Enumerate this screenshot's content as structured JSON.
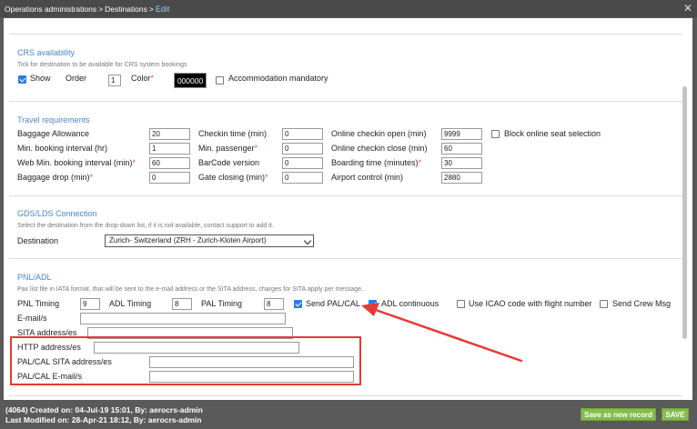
{
  "breadcrumb": {
    "items": [
      "Operations administrations",
      "Destinations",
      "Edit"
    ],
    "separator": ">"
  },
  "window": {
    "close_glyph": "✕"
  },
  "crs": {
    "title": "CRS availability",
    "description": "Tick for destination to be available for CRS system bookings",
    "show_label": "Show",
    "show_checked": true,
    "order_label": "Order",
    "order_value": "1",
    "color_label": "Color",
    "color_value": "000000",
    "accommodation_label": "Accommodation mandatory",
    "accommodation_checked": false
  },
  "travel": {
    "title": "Travel requirements",
    "baggage_allowance_label": "Baggage Allowance",
    "baggage_allowance_value": "20",
    "min_booking_label": "Min. booking interval (hr)",
    "min_booking_value": "1",
    "web_min_booking_label": "Web Min. booking interval (min)",
    "web_min_booking_value": "60",
    "baggage_drop_label": "Baggage drop (min)",
    "baggage_drop_value": "0",
    "checkin_time_label": "Checkin time (min)",
    "checkin_time_value": "0",
    "min_passenger_label": "Min. passenger",
    "min_passenger_value": "0",
    "barcode_label": "BarCode version",
    "barcode_value": "0",
    "gate_closing_label": "Gate closing (min)",
    "gate_closing_value": "0",
    "online_open_label": "Online checkin open (min)",
    "online_open_value": "9999",
    "online_close_label": "Online checkin close (min)",
    "online_close_value": "60",
    "boarding_label": "Boarding time (minutes)",
    "boarding_value": "30",
    "airport_control_label": "Airport control (min)",
    "airport_control_value": "2880",
    "block_online_label": "Block online seat selection",
    "block_online_checked": false,
    "required_mark": "*"
  },
  "gds": {
    "title": "GDS/LDS Connection",
    "description": "Select the destination from the drop-down list, if it is not available, contact support to add it.",
    "destination_label": "Destination",
    "destination_value": "Zurich- Switzerland (ZRH - Zurich-Kloten Airport)"
  },
  "pnl": {
    "title": "PNL/ADL",
    "description": "Pax list file in IATA format, that will be sent to the e-mail address or the SITA address, charges for SITA apply per message..",
    "pnl_timing_label": "PNL Timing",
    "pnl_timing_value": "9",
    "adl_timing_label": "ADL Timing",
    "adl_timing_value": "8",
    "pal_timing_label": "PAL Timing",
    "pal_timing_value": "8",
    "send_palcal_label": "Send PAL/CAL",
    "send_palcal_checked": true,
    "adl_continuous_label": "ADL continuous",
    "adl_continuous_checked": true,
    "icao_label": "Use ICAO code with flight number",
    "icao_checked": false,
    "send_crew_label": "Send Crew Msg",
    "send_crew_checked": false,
    "email_label": "E-mail/s",
    "email_value": "",
    "sita_label": "SITA address/es",
    "sita_value": "",
    "http_label": "HTTP address/es",
    "http_value": "",
    "palcal_sita_label": "PAL/CAL SITA address/es",
    "palcal_sita_value": "",
    "palcal_email_label": "PAL/CAL E-mail/s",
    "palcal_email_value": ""
  },
  "footer": {
    "created": "(4064) Created on: 04-Jul-19 15:01, By: aerocrs-admin",
    "modified": "Last Modified on: 28-Apr-21 18:12, By: aerocrs-admin",
    "save_as_new_label": "Save as new record",
    "save_label": "SAVE"
  },
  "colors": {
    "accent_blue": "#4a86c5",
    "required_red": "#d9534f",
    "button_green": "#84bd4a",
    "annotation_red": "#e53935",
    "header_bg": "#4a4a4a"
  }
}
